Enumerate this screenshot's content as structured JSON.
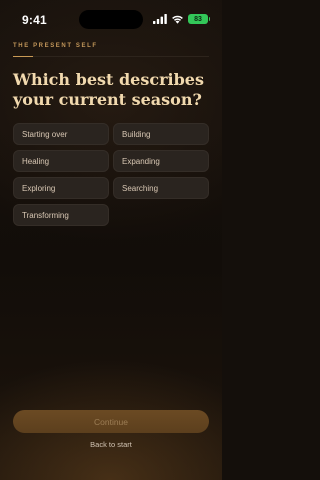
{
  "status_bar": {
    "time": "9:41",
    "battery": "83",
    "signal_icon": "signal-bars-icon",
    "wifi_icon": "wifi-icon",
    "battery_icon": "battery-charging-icon"
  },
  "progress": {
    "fraction": 0.1,
    "section_label": "THE PRESENT SELF"
  },
  "question": {
    "title": "Which best describes your current season?"
  },
  "options": [
    "Starting over",
    "Building",
    "Healing",
    "Expanding",
    "Exploring",
    "Searching",
    "Transforming"
  ],
  "actions": {
    "continue_label": "Continue",
    "back_label": "Back to start"
  },
  "colors": {
    "accent": "#c99a55",
    "background": "#140f0b",
    "title": "#f1d9ae",
    "option_bg": "#2a241f"
  }
}
